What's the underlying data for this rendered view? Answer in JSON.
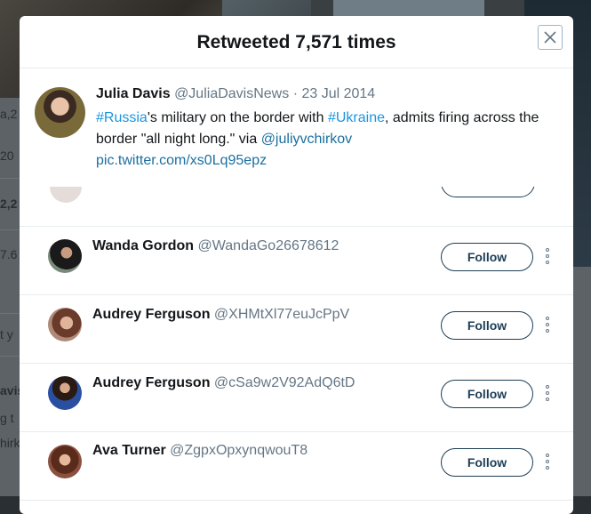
{
  "modal": {
    "title": "Retweeted 7,571 times"
  },
  "tweet": {
    "name": "Julia Davis",
    "handle": "@JuliaDavisNews",
    "sep": "·",
    "date": "23 Jul 2014",
    "hashtag1": "#Russia",
    "text1": "'s military on the border with ",
    "hashtag2": "#Ukraine",
    "text2": ", admits firing across the border \"all night long.\" via ",
    "mention": "@juliyvchirkov",
    "pic_link": "pic.twitter.com/xs0Lq95epz"
  },
  "users": [
    {
      "name": "Wanda Gordon",
      "handle": "@WandaGo26678612",
      "follow_label": "Follow"
    },
    {
      "name": "Audrey Ferguson",
      "handle": "@XHMtXl77euJcPpV",
      "follow_label": "Follow"
    },
    {
      "name": "Audrey Ferguson",
      "handle": "@cSa9w2V92AdQ6tD",
      "follow_label": "Follow"
    },
    {
      "name": "Ava Turner",
      "handle": "@ZgpxOpxynqwouT8",
      "follow_label": "Follow"
    }
  ],
  "background_fragments": [
    "a,2",
    "20",
    "2,2",
    "7.6",
    "t y",
    "avis",
    "g t",
    "hirk"
  ],
  "icons": {
    "close": "close-icon",
    "more": "more-vertical-icon"
  },
  "colors": {
    "link": "#1b95e0",
    "button_border": "#1d3e57",
    "muted": "#657786"
  }
}
